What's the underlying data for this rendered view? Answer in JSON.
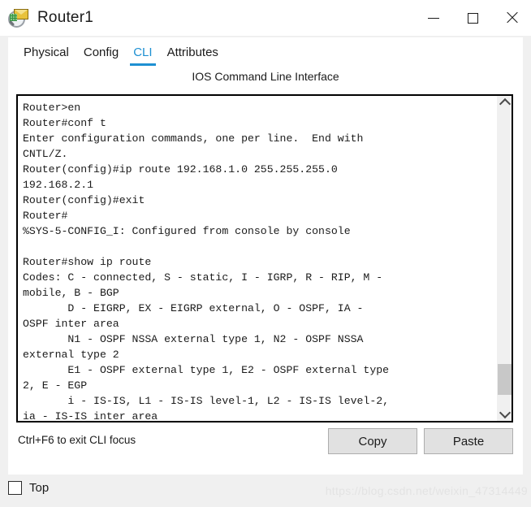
{
  "window": {
    "title": "Router1",
    "icon": "packet-tracer-inspect-icon",
    "controls": {
      "minimize": "—",
      "maximize": "□",
      "close": "✕"
    }
  },
  "tabs": [
    {
      "label": "Physical",
      "active": false
    },
    {
      "label": "Config",
      "active": false
    },
    {
      "label": "CLI",
      "active": true
    },
    {
      "label": "Attributes",
      "active": false
    }
  ],
  "cli": {
    "header": "IOS Command Line Interface",
    "accent_color": "#1e90d2",
    "text": "Router>en\nRouter#conf t\nEnter configuration commands, one per line.  End with\nCNTL/Z.\nRouter(config)#ip route 192.168.1.0 255.255.255.0\n192.168.2.1\nRouter(config)#exit\nRouter#\n%SYS-5-CONFIG_I: Configured from console by console\n\nRouter#show ip route\nCodes: C - connected, S - static, I - IGRP, R - RIP, M -\nmobile, B - BGP\n       D - EIGRP, EX - EIGRP external, O - OSPF, IA -\nOSPF inter area\n       N1 - OSPF NSSA external type 1, N2 - OSPF NSSA\nexternal type 2\n       E1 - OSPF external type 1, E2 - OSPF external type\n2, E - EGP\n       i - IS-IS, L1 - IS-IS level-1, L2 - IS-IS level-2,\nia - IS-IS inter area",
    "scrollbar": {
      "up_arrow": "scroll-up-chevron",
      "down_arrow": "scroll-down-chevron"
    }
  },
  "bottom": {
    "hint": "Ctrl+F6 to exit CLI focus",
    "copy_label": "Copy",
    "paste_label": "Paste"
  },
  "footer": {
    "top_checkbox_label": "Top",
    "top_checked": false,
    "watermark": "https://blog.csdn.net/weixin_47314449"
  }
}
